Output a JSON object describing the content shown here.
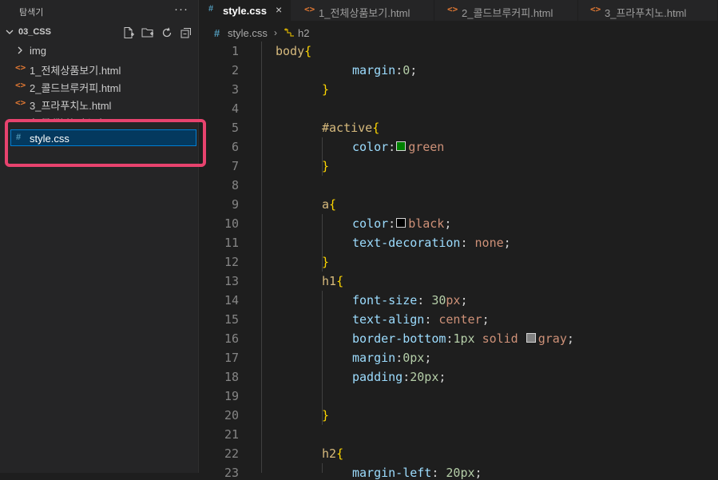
{
  "sidebar": {
    "title": "탐색기",
    "more": "···",
    "folder": "03_CSS",
    "items": [
      {
        "label": "img",
        "type": "folder"
      },
      {
        "label": "1_전체상품보기.html",
        "type": "html"
      },
      {
        "label": "2_콜드브루커피.html",
        "type": "html"
      },
      {
        "label": "3_프라푸치노.html",
        "type": "html"
      },
      {
        "label": "4_블렌디드.html",
        "type": "html"
      },
      {
        "label": "style.css",
        "type": "css"
      }
    ]
  },
  "tabs": [
    {
      "label": "style.css",
      "icon": "#",
      "active": true,
      "close": "×"
    },
    {
      "label": "1_전체상품보기.html",
      "icon": "<>"
    },
    {
      "label": "2_콜드브루커피.html",
      "icon": "<>"
    },
    {
      "label": "3_프라푸치노.html",
      "icon": "<>"
    }
  ],
  "breadcrumb": {
    "file": "style.css",
    "symbol": "h2"
  },
  "colors": {
    "accent": "#007fd4",
    "highlight": "#e8436e",
    "html_icon": "#e37933",
    "css_icon": "#519aba"
  },
  "code": {
    "line_numbers": [
      "1",
      "2",
      "3",
      "4",
      "5",
      "6",
      "7",
      "8",
      "9",
      "10",
      "11",
      "12",
      "13",
      "14",
      "15",
      "16",
      "17",
      "18",
      "19",
      "20",
      "21",
      "22",
      "23"
    ],
    "l1_sel": "body",
    "l2_prop": "margin",
    "l2_val": "0",
    "l5_sel": "#active",
    "l6_prop": "color",
    "l6_val": "green",
    "l9_sel": "a",
    "l10_prop": "color",
    "l10_val": "black",
    "l11_prop": "text-decoration",
    "l11_val": "none",
    "l13_sel": "h1",
    "l14_prop": "font-size",
    "l14_num": "30",
    "l14_unit": "px",
    "l15_prop": "text-align",
    "l15_val": "center",
    "l16_prop": "border-bottom",
    "l16_num": "1px",
    "l16_val": "solid",
    "l16_color": "gray",
    "l17_prop": "margin",
    "l17_num": "0px",
    "l18_prop": "padding",
    "l18_num": "20px",
    "l22_sel": "h2",
    "l23_prop": "margin-left",
    "l23_num": "20px"
  }
}
